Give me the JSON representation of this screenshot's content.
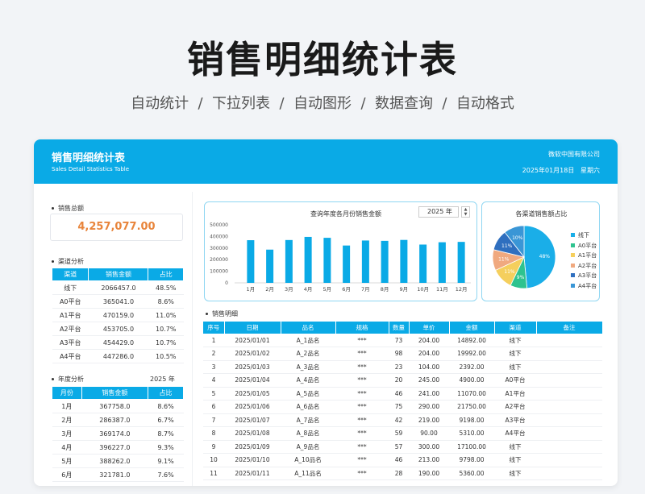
{
  "hero": {
    "title": "销售明细统计表",
    "subtitle": "自动统计  /  下拉列表  /  自动图形  /  数据查询  /  自动格式"
  },
  "banner": {
    "title": "销售明细统计表",
    "subtitle": "Sales Detail Statistics Table",
    "company": "微软中国有限公司",
    "date": "2025年01月18日   星期六"
  },
  "total": {
    "label": "销售总额",
    "value": "4,257,077.00"
  },
  "channel": {
    "label": "渠道分析",
    "headers": [
      "渠道",
      "销售金额",
      "占比"
    ],
    "rows": [
      [
        "线下",
        "2066457.0",
        "48.5%"
      ],
      [
        "A0平台",
        "365041.0",
        "8.6%"
      ],
      [
        "A1平台",
        "470159.0",
        "11.0%"
      ],
      [
        "A2平台",
        "453705.0",
        "10.7%"
      ],
      [
        "A3平台",
        "454429.0",
        "10.7%"
      ],
      [
        "A4平台",
        "447286.0",
        "10.5%"
      ]
    ]
  },
  "annual": {
    "label": "年度分析",
    "year": "2025 年",
    "headers": [
      "月份",
      "销售金额",
      "占比"
    ],
    "rows": [
      [
        "1月",
        "367758.0",
        "8.6%"
      ],
      [
        "2月",
        "286387.0",
        "6.7%"
      ],
      [
        "3月",
        "369174.0",
        "8.7%"
      ],
      [
        "4月",
        "396227.0",
        "9.3%"
      ],
      [
        "5月",
        "388262.0",
        "9.1%"
      ],
      [
        "6月",
        "321781.0",
        "7.6%"
      ]
    ]
  },
  "barpanel": {
    "title": "查询年度各月份销售金额",
    "year": "2025 年",
    "up": "▲",
    "down": "▼"
  },
  "piepanel": {
    "title": "各渠道销售额占比"
  },
  "detail_label": "销售明细",
  "detail": {
    "headers": [
      "序号",
      "日期",
      "品名",
      "规格",
      "数量",
      "单价",
      "金额",
      "渠道",
      "备注"
    ],
    "rows": [
      [
        "1",
        "2025/01/01",
        "A_1品名",
        "***",
        "73",
        "204.00",
        "14892.00",
        "线下",
        ""
      ],
      [
        "2",
        "2025/01/02",
        "A_2品名",
        "***",
        "98",
        "204.00",
        "19992.00",
        "线下",
        ""
      ],
      [
        "3",
        "2025/01/03",
        "A_3品名",
        "***",
        "23",
        "104.00",
        "2392.00",
        "线下",
        ""
      ],
      [
        "4",
        "2025/01/04",
        "A_4品名",
        "***",
        "20",
        "245.00",
        "4900.00",
        "A0平台",
        ""
      ],
      [
        "5",
        "2025/01/05",
        "A_5品名",
        "***",
        "46",
        "241.00",
        "11070.00",
        "A1平台",
        ""
      ],
      [
        "6",
        "2025/01/06",
        "A_6品名",
        "***",
        "75",
        "290.00",
        "21750.00",
        "A2平台",
        ""
      ],
      [
        "7",
        "2025/01/07",
        "A_7品名",
        "***",
        "42",
        "219.00",
        "9198.00",
        "A3平台",
        ""
      ],
      [
        "8",
        "2025/01/08",
        "A_8品名",
        "***",
        "59",
        "90.00",
        "5310.00",
        "A4平台",
        ""
      ],
      [
        "9",
        "2025/01/09",
        "A_9品名",
        "***",
        "57",
        "300.00",
        "17100.00",
        "线下",
        ""
      ],
      [
        "10",
        "2025/01/10",
        "A_10品名",
        "***",
        "46",
        "213.00",
        "9798.00",
        "线下",
        ""
      ],
      [
        "11",
        "2025/01/11",
        "A_11品名",
        "***",
        "28",
        "190.00",
        "5360.00",
        "线下",
        ""
      ]
    ]
  },
  "chart_data": [
    {
      "type": "bar",
      "title": "查询年度各月份销售金额",
      "categories": [
        "1月",
        "2月",
        "3月",
        "4月",
        "5月",
        "6月",
        "7月",
        "8月",
        "9月",
        "10月",
        "11月",
        "12月"
      ],
      "values": [
        367758,
        286387,
        369174,
        396227,
        388262,
        321781,
        365000,
        362000,
        370000,
        330000,
        350000,
        353000
      ],
      "ylim": [
        0,
        500000
      ],
      "yticks": [
        "500000",
        "400000",
        "300000",
        "200000",
        "100000",
        "0"
      ],
      "color": "#0aaae6"
    },
    {
      "type": "pie",
      "title": "各渠道销售额占比",
      "labels": [
        "线下",
        "A0平台",
        "A1平台",
        "A2平台",
        "A3平台",
        "A4平台"
      ],
      "values": [
        48.5,
        8.6,
        11.0,
        10.7,
        10.7,
        10.5
      ],
      "slice_labels": [
        "48%",
        "9%",
        "11%",
        "11%",
        "11%",
        "10%"
      ],
      "colors": [
        "#1aaee8",
        "#2ec38f",
        "#f5cf5d",
        "#f0a97f",
        "#2f6fbf",
        "#3a96d6"
      ],
      "legend": "right"
    }
  ]
}
